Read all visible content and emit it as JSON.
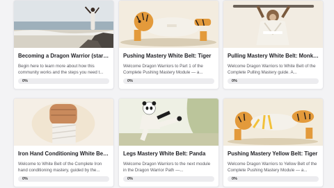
{
  "courses": [
    {
      "title": "Becoming a Dragon Warrior (start ...",
      "description": "Begin here to learn more about how this community works and the steps you need t...",
      "progress_label": "0%",
      "progress": 0,
      "image": "warrior-on-beach"
    },
    {
      "title": "Pushing Mastery White Belt: Tiger",
      "description": "Welcome Dragon Warriors to Part 1 of the Complete Pushing Mastery Module — a...",
      "progress_label": "0%",
      "progress": 0,
      "image": "tiger-pushup-white-belt"
    },
    {
      "title": "Pulling Mastery White Belt: Monkey",
      "description": "Welcome Dragon Warriors to White Belt of the Complete Pulling Mastery guide. A...",
      "progress_label": "0%",
      "progress": 0,
      "image": "monkey-pullup-white-belt"
    },
    {
      "title": "Iron Hand Conditioning White Belt...",
      "description": "Welcome to White Belt of the Complete Iron hand conditioning mastery, guided by the...",
      "progress_label": "0%",
      "progress": 0,
      "image": "wrapped-fist"
    },
    {
      "title": "Legs Mastery White Belt: Panda",
      "description": "Welcome Dragon Warriors to the next module in the Dragon Warrior Path —...",
      "progress_label": "0%",
      "progress": 0,
      "image": "panda-kick-white-belt"
    },
    {
      "title": "Pushing Mastery Yellow Belt: Tiger",
      "description": "Welcome Dragon Warriors to Yellow Belt of the Complete Pushing Mastery Module — a...",
      "progress_label": "0%",
      "progress": 0,
      "image": "tiger-pushup-yellow-belt"
    }
  ],
  "colors": {
    "background": "#f3f3f5",
    "progress_track": "#ececef",
    "progress_fill": "#d0a12a",
    "tiger_orange": "#e39a3b",
    "white_gi": "#f4f1ea",
    "yellow_belt": "#f2c13a"
  }
}
